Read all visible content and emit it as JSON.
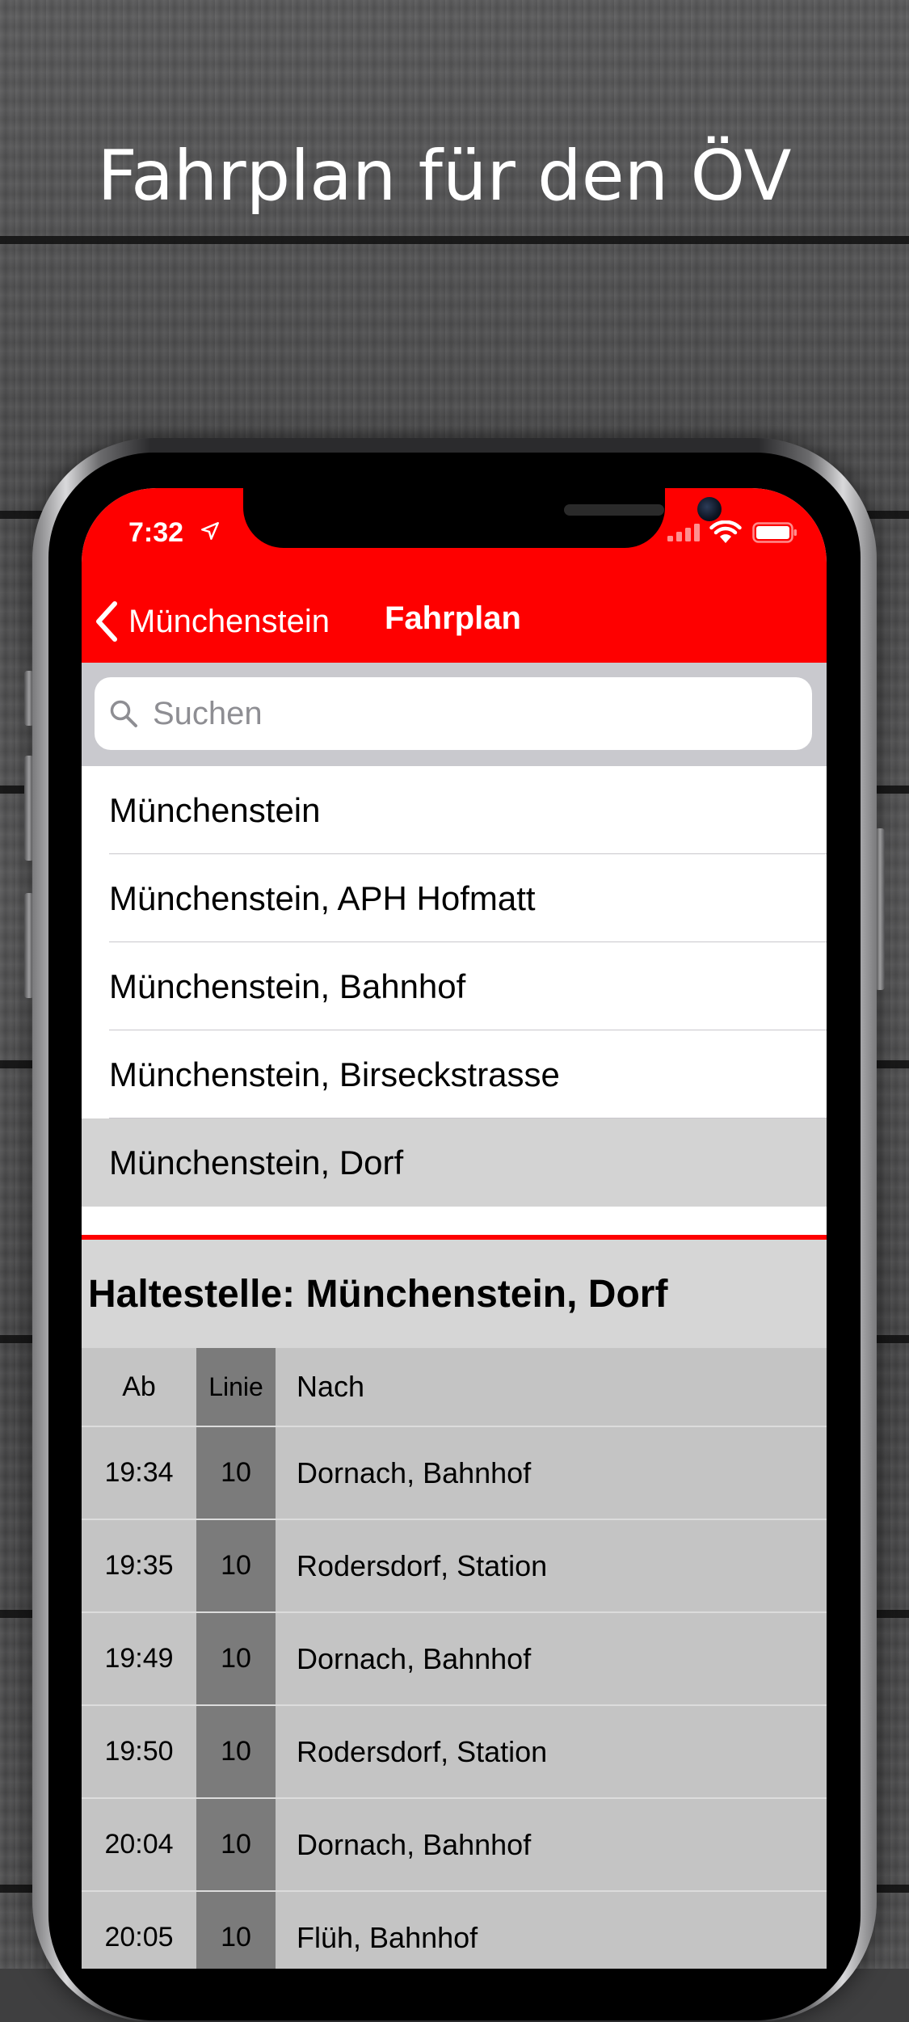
{
  "promo": {
    "headline": "Fahrplan für den ÖV"
  },
  "status_bar": {
    "time": "7:32",
    "icons": [
      "location-arrow-icon",
      "signal-icon",
      "wifi-icon",
      "battery-icon"
    ]
  },
  "nav": {
    "back_label": "Münchenstein",
    "title": "Fahrplan",
    "color": "#fe0000"
  },
  "search": {
    "placeholder": "Suchen",
    "value": ""
  },
  "results": [
    {
      "label": "Münchenstein",
      "selected": false
    },
    {
      "label": "Münchenstein, APH Hofmatt",
      "selected": false
    },
    {
      "label": "Münchenstein, Bahnhof",
      "selected": false
    },
    {
      "label": "Münchenstein, Birseckstrasse",
      "selected": false
    },
    {
      "label": "Münchenstein, Dorf",
      "selected": true
    }
  ],
  "timetable": {
    "stop_title": "Haltestelle: Münchenstein, Dorf",
    "headers": {
      "time": "Ab",
      "line": "Linie",
      "destination": "Nach"
    },
    "rows": [
      {
        "time": "19:34",
        "line": "10",
        "destination": "Dornach, Bahnhof"
      },
      {
        "time": "19:35",
        "line": "10",
        "destination": "Rodersdorf, Station"
      },
      {
        "time": "19:49",
        "line": "10",
        "destination": "Dornach, Bahnhof"
      },
      {
        "time": "19:50",
        "line": "10",
        "destination": "Rodersdorf, Station"
      },
      {
        "time": "20:04",
        "line": "10",
        "destination": "Dornach, Bahnhof"
      },
      {
        "time": "20:05",
        "line": "10",
        "destination": "Flüh, Bahnhof"
      }
    ]
  }
}
